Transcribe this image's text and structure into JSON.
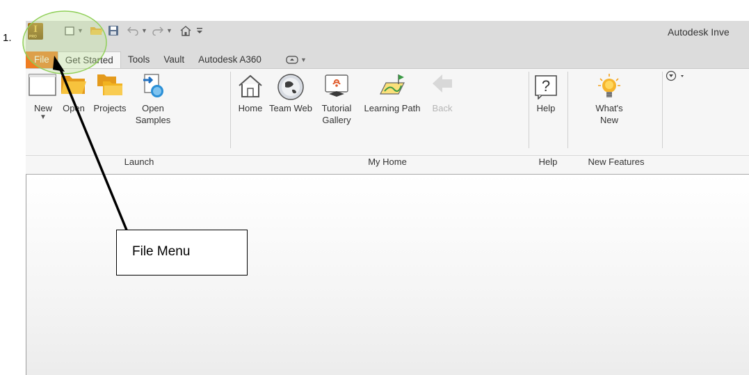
{
  "step_number": "1.",
  "window": {
    "title": "Autodesk Inve"
  },
  "app_logo": {
    "letter": "I",
    "badge": "PRO"
  },
  "quick_access": [
    "new-icon",
    "open-icon",
    "save-icon",
    "undo-icon",
    "redo-icon",
    "home-icon",
    "customize-icon"
  ],
  "tabs": [
    {
      "label": "File"
    },
    {
      "label": "Get Started"
    },
    {
      "label": "Tools"
    },
    {
      "label": "Vault"
    },
    {
      "label": "Autodesk A360"
    }
  ],
  "ribbon": {
    "buttons": {
      "new": "New",
      "open": "Open",
      "projects": "Projects",
      "open_samples_1": "Open",
      "open_samples_2": "Samples",
      "home": "Home",
      "team_web": "Team Web",
      "tutorial_1": "Tutorial",
      "tutorial_2": "Gallery",
      "learning_path": "Learning Path",
      "back": "Back",
      "help": "Help",
      "whats_new_1": "What's",
      "whats_new_2": "New"
    },
    "groups": {
      "launch": "Launch",
      "my_home": "My Home",
      "help": "Help",
      "new_features": "New Features"
    }
  },
  "annotation": {
    "label": "File Menu"
  },
  "colors": {
    "file_tab": "#ef7d22",
    "highlight_circle": "#8fcf57",
    "ribbon_bg": "#f6f6f6"
  }
}
